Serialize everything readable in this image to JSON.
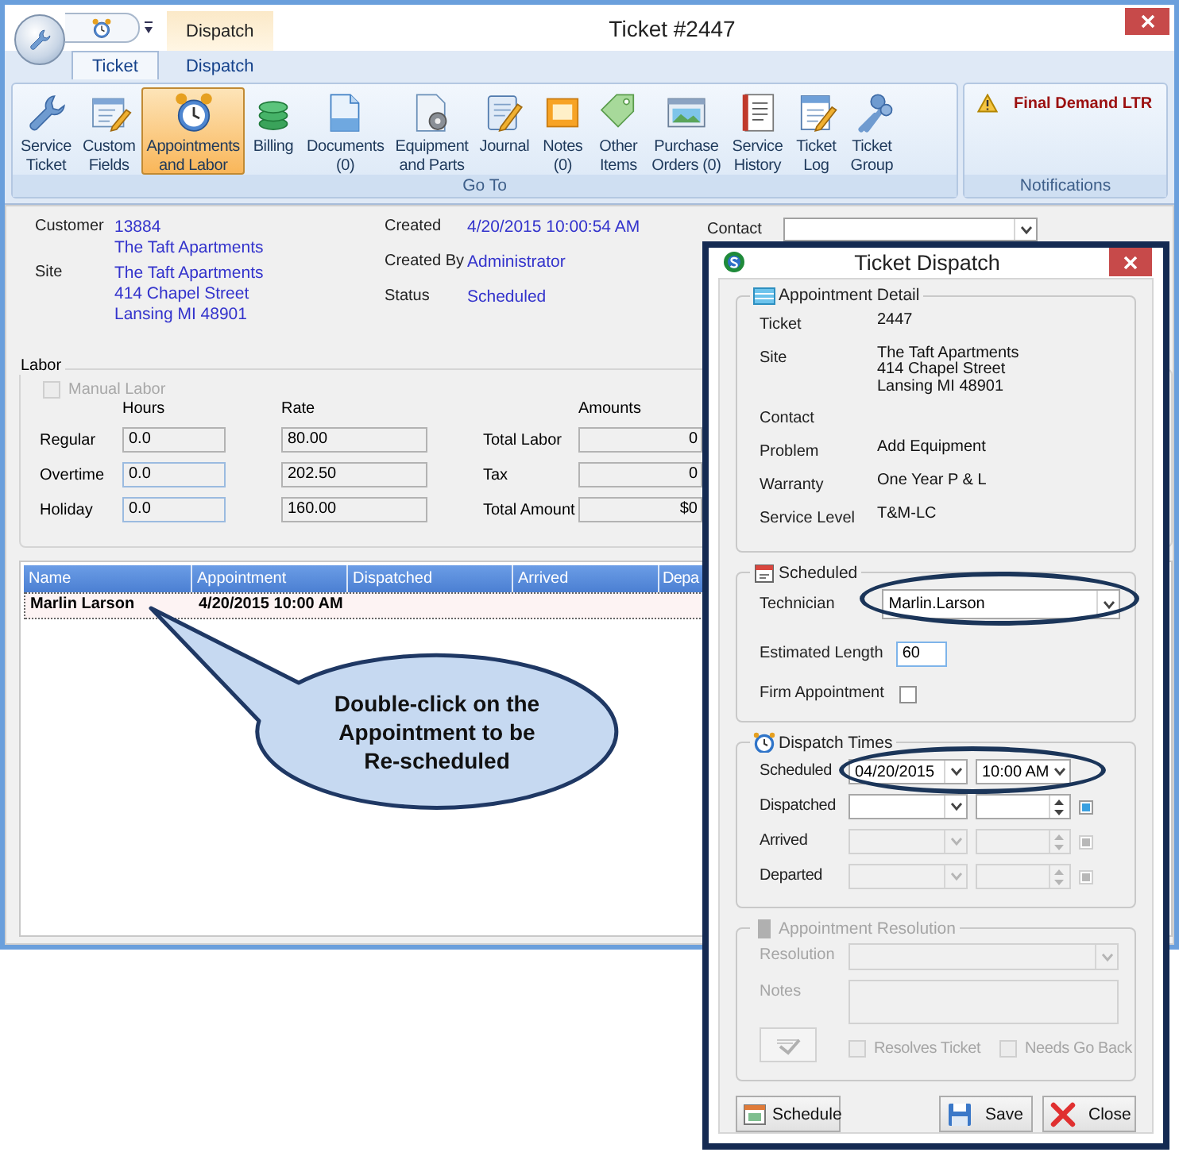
{
  "window": {
    "title": "Ticket #2447",
    "contextual_tab": "Dispatch"
  },
  "ribbon": {
    "tabs": [
      {
        "label": "Ticket",
        "selected": true
      },
      {
        "label": "Dispatch",
        "selected": false
      }
    ],
    "groups": [
      {
        "label": "Go To",
        "buttons": [
          {
            "label": "Service\nTicket",
            "selected": false
          },
          {
            "label": "Custom\nFields",
            "selected": false
          },
          {
            "label": "Appointments\nand Labor",
            "selected": true
          },
          {
            "label": "Billing",
            "selected": false
          },
          {
            "label": "Documents\n(0)",
            "selected": false
          },
          {
            "label": "Equipment\nand Parts",
            "selected": false
          },
          {
            "label": "Journal",
            "selected": false
          },
          {
            "label": "Notes\n(0)",
            "selected": false
          },
          {
            "label": "Other\nItems",
            "selected": false
          },
          {
            "label": "Purchase\nOrders (0)",
            "selected": false
          },
          {
            "label": "Service\nHistory",
            "selected": false
          },
          {
            "label": "Ticket\nLog",
            "selected": false
          },
          {
            "label": "Ticket\nGroup",
            "selected": false
          }
        ]
      },
      {
        "label": "Notifications",
        "alerts": [
          {
            "text": "Final Demand LTR"
          }
        ]
      }
    ]
  },
  "ticket_info": {
    "left": [
      {
        "label": "Customer",
        "value_lines": [
          "13884",
          "The Taft Apartments"
        ]
      },
      {
        "label": "Site",
        "value_lines": [
          "The Taft Apartments",
          "414 Chapel Street",
          "Lansing MI 48901"
        ]
      }
    ],
    "right": [
      {
        "label": "Created",
        "value": "4/20/2015 10:00:54 AM"
      },
      {
        "label": "Created By",
        "value": "Administrator"
      },
      {
        "label": "Status",
        "value": "Scheduled"
      }
    ],
    "contact": {
      "label": "Contact"
    }
  },
  "labor": {
    "title": "Labor",
    "manual_labor": {
      "label": "Manual Labor",
      "checked": false,
      "disabled": true
    },
    "headings": [
      "Hours",
      "Rate",
      "Amounts"
    ],
    "rows": [
      {
        "label": "Regular",
        "hours": "0.0",
        "rate": "80.00",
        "editable": false
      },
      {
        "label": "Overtime",
        "hours": "0.0",
        "rate": "202.50",
        "editable": true
      },
      {
        "label": "Holiday",
        "hours": "0.0",
        "rate": "160.00",
        "editable": true
      }
    ],
    "totals": [
      {
        "label": "Total Labor",
        "value": "0"
      },
      {
        "label": "Tax",
        "value": "0"
      },
      {
        "label": "Total Amount",
        "value": "$0"
      }
    ]
  },
  "appointments": {
    "columns": [
      "Name",
      "Appointment",
      "Dispatched",
      "Arrived",
      "Depa"
    ],
    "rows": [
      {
        "cells": [
          "Marlin Larson",
          "4/20/2015 10:00 AM"
        ],
        "selected": true
      }
    ]
  },
  "callout": {
    "text": "Double-click on the Appointment to be Re-scheduled"
  },
  "dialog": {
    "title": "Ticket Dispatch",
    "appointment_detail": {
      "title": "Appointment Detail",
      "fields": [
        {
          "label": "Ticket",
          "value_lines": [
            "2447"
          ]
        },
        {
          "label": "Site",
          "value_lines": [
            "The Taft Apartments",
            "414 Chapel Street",
            "Lansing MI 48901"
          ]
        },
        {
          "label": "Contact"
        },
        {
          "label": "Problem",
          "value_lines": [
            "Add Equipment"
          ]
        },
        {
          "label": "Warranty",
          "value_lines": [
            "One Year P & L"
          ]
        },
        {
          "label": "Service Level",
          "value_lines": [
            "T&M-LC"
          ]
        }
      ]
    },
    "scheduled": {
      "title": "Scheduled",
      "technician": {
        "label": "Technician",
        "value": "Marlin.Larson",
        "highlighted": true
      },
      "estimated_length": {
        "label": "Estimated Length",
        "value": "60"
      },
      "firm_appointment": {
        "label": "Firm Appointment",
        "checked": false
      }
    },
    "dispatch_times": {
      "title": "Dispatch Times",
      "rows": [
        {
          "label": "Scheduled",
          "kind": "dropdown",
          "date": "04/20/2015",
          "time": "10:00 AM",
          "disabled": false,
          "highlighted": true
        },
        {
          "label": "Dispatched",
          "kind": "spinner",
          "disabled": false,
          "highlighted": false
        },
        {
          "label": "Arrived",
          "kind": "spinner",
          "disabled": true,
          "highlighted": false
        },
        {
          "label": "Departed",
          "kind": "spinner",
          "disabled": true,
          "highlighted": false
        }
      ]
    },
    "resolution": {
      "title": "Appointment Resolution",
      "disabled": true,
      "resolution_label": "Resolution",
      "notes_label": "Notes",
      "resolves_ticket": {
        "label": "Resolves Ticket",
        "checked": false
      },
      "needs_go_back": {
        "label": "Needs Go Back",
        "checked": false
      }
    },
    "buttons": [
      {
        "label": "Schedule"
      },
      {
        "label": "Save"
      },
      {
        "label": "Close"
      }
    ]
  }
}
